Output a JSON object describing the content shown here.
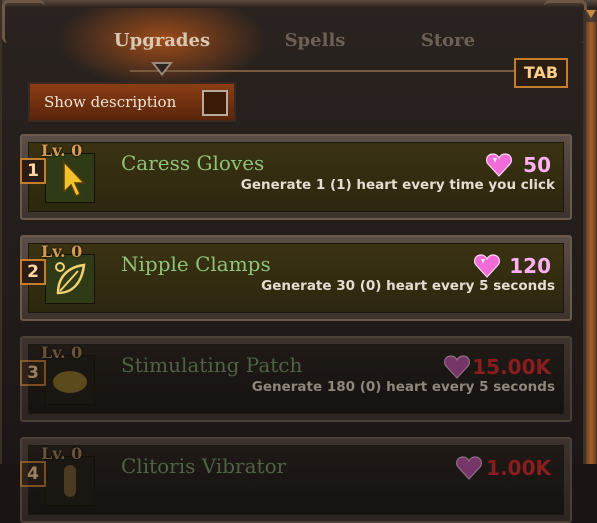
{
  "tabs": [
    {
      "label": "Upgrades",
      "active": true
    },
    {
      "label": "Spells",
      "active": false
    },
    {
      "label": "Store",
      "active": false
    }
  ],
  "tab_key": "TAB",
  "toggle": {
    "label": "Show description",
    "checked": false
  },
  "upgrades": [
    {
      "hotkey": "1",
      "level": "Lv. 0",
      "name": "Caress Gloves",
      "description": "Generate 1 (1) heart every time you click",
      "cost": "50",
      "icon": "cursor-icon",
      "affordable": true
    },
    {
      "hotkey": "2",
      "level": "Lv. 0",
      "name": "Nipple Clamps",
      "description": "Generate 30 (0) heart every 5 seconds",
      "cost": "120",
      "icon": "leaf-icon",
      "affordable": true
    },
    {
      "hotkey": "3",
      "level": "Lv. 0",
      "name": "Stimulating Patch",
      "description": "Generate 180 (0) heart every 5 seconds",
      "cost": "15.00K",
      "icon": "patch-icon",
      "affordable": false
    },
    {
      "hotkey": "4",
      "level": "Lv. 0",
      "name": "Clitoris Vibrator",
      "description": "",
      "cost": "1.00K",
      "icon": "vibrator-icon",
      "affordable": false
    }
  ],
  "colors": {
    "accent": "#c57c2b",
    "affordable_cost": "#ffb0f0",
    "locked_cost": "#8a1d1d",
    "name_green": "#8fc27a"
  }
}
